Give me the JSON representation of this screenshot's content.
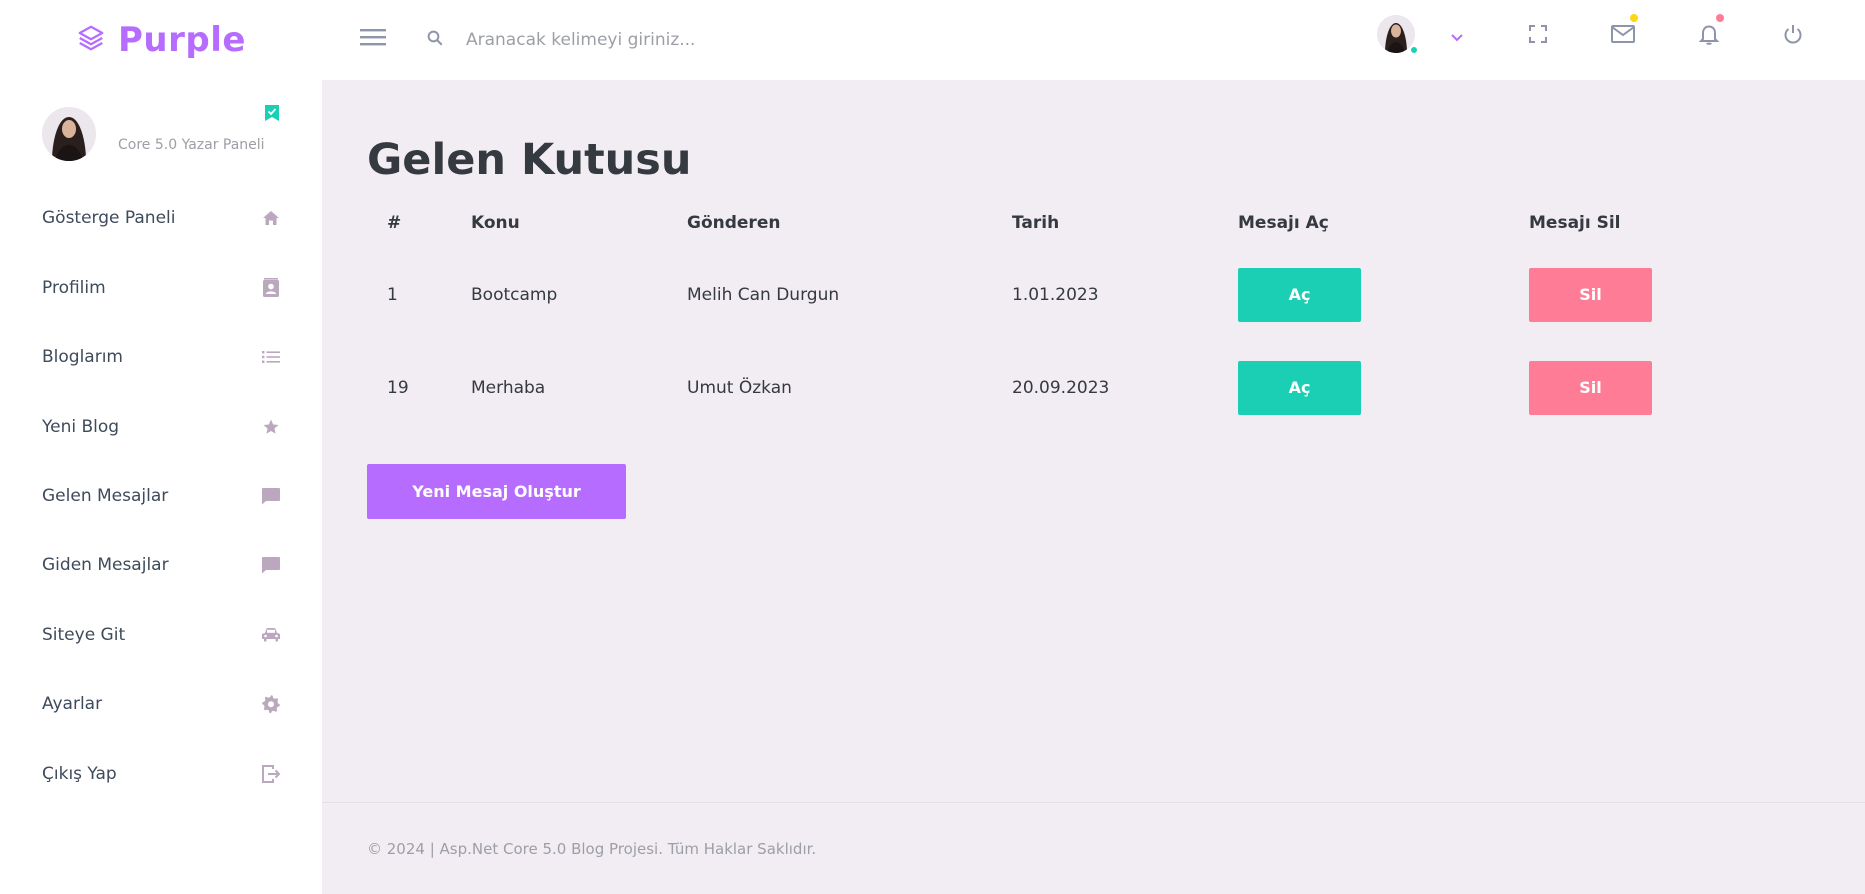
{
  "brand": {
    "name": "Purple"
  },
  "search": {
    "placeholder": "Aranacak kelimeyi giriniz..."
  },
  "colors": {
    "primary": "#b66dff",
    "success": "#1bcfb4",
    "danger": "#fe7c96",
    "warning": "#fed713",
    "background": "#f2edf3"
  },
  "navbar": {
    "icons": [
      "menu-icon",
      "search-icon",
      "avatar",
      "chevron-down-icon",
      "fullscreen-icon",
      "mail-icon",
      "bell-icon",
      "power-icon"
    ]
  },
  "sidebar": {
    "profile_label": "Core 5.0 Yazar Paneli",
    "items": [
      {
        "label": "Gösterge Paneli",
        "icon": "home-icon"
      },
      {
        "label": "Profilim",
        "icon": "contact-card-icon"
      },
      {
        "label": "Bloglarım",
        "icon": "list-icon"
      },
      {
        "label": "Yeni Blog",
        "icon": "star-icon"
      },
      {
        "label": "Gelen Mesajlar",
        "icon": "message-icon"
      },
      {
        "label": "Giden Mesajlar",
        "icon": "message-icon"
      },
      {
        "label": "Siteye Git",
        "icon": "car-icon"
      },
      {
        "label": "Ayarlar",
        "icon": "gear-icon"
      },
      {
        "label": "Çıkış Yap",
        "icon": "logout-icon"
      }
    ]
  },
  "main": {
    "title": "Gelen Kutusu",
    "table": {
      "headers": [
        "#",
        "Konu",
        "Gönderen",
        "Tarih",
        "Mesajı Aç",
        "Mesajı Sil"
      ],
      "rows": [
        {
          "id": "1",
          "subject": "Bootcamp",
          "sender": "Melih Can Durgun",
          "date": "1.01.2023",
          "open_label": "Aç",
          "delete_label": "Sil"
        },
        {
          "id": "19",
          "subject": "Merhaba",
          "sender": "Umut Özkan",
          "date": "20.09.2023",
          "open_label": "Aç",
          "delete_label": "Sil"
        }
      ]
    },
    "new_message_label": "Yeni Mesaj Oluştur"
  },
  "footer": {
    "text": "© 2024 | Asp.Net Core 5.0 Blog Projesi. Tüm Haklar Saklıdır."
  }
}
